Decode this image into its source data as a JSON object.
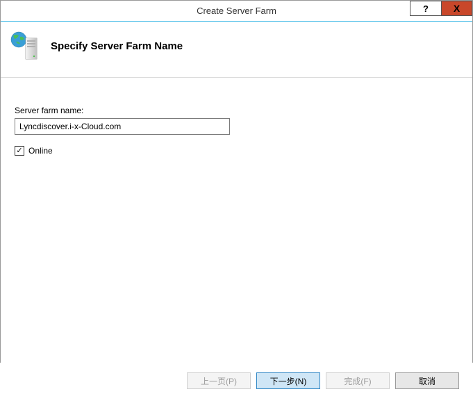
{
  "titlebar": {
    "title": "Create Server Farm",
    "help_symbol": "?",
    "close_symbol": "X"
  },
  "header": {
    "heading": "Specify Server Farm Name"
  },
  "form": {
    "server_farm_name_label": "Server farm name:",
    "server_farm_name_value": "Lyncdiscover.i-x-Cloud.com",
    "online_label": "Online",
    "online_checked": "✓"
  },
  "footer": {
    "prev_label": "上一页(P)",
    "next_label": "下一步(N)",
    "finish_label": "完成(F)",
    "cancel_label": "取消"
  }
}
